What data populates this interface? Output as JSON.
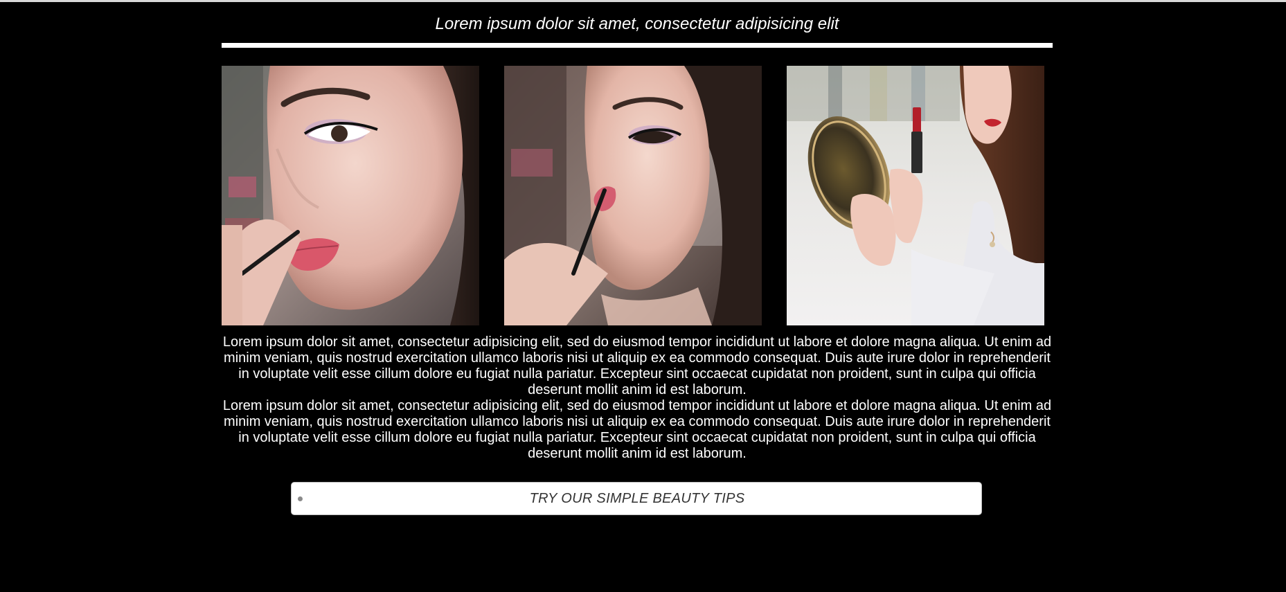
{
  "header": {
    "headline": "Lorem ipsum dolor sit amet, consectetur adipisicing elit"
  },
  "gallery": {
    "photos": [
      {
        "subject": "makeup-artist-applying-lip-liner-closeup"
      },
      {
        "subject": "makeup-artist-applying-lip-liner-profile"
      },
      {
        "subject": "woman-applying-red-lipstick-with-compact-mirror"
      }
    ]
  },
  "content": {
    "paragraphs": [
      "Lorem ipsum dolor sit amet, consectetur adipisicing elit, sed do eiusmod tempor incididunt ut labore et dolore magna aliqua. Ut enim ad minim veniam, quis nostrud exercitation ullamco laboris nisi ut aliquip ex ea commodo consequat. Duis aute irure dolor in reprehenderit in voluptate velit esse cillum dolore eu fugiat nulla pariatur. Excepteur sint occaecat cupidatat non proident, sunt in culpa qui officia deserunt mollit anim id est laborum.",
      "Lorem ipsum dolor sit amet, consectetur adipisicing elit, sed do eiusmod tempor incididunt ut labore et dolore magna aliqua. Ut enim ad minim veniam, quis nostrud exercitation ullamco laboris nisi ut aliquip ex ea commodo consequat. Duis aute irure dolor in reprehenderit in voluptate velit esse cillum dolore eu fugiat nulla pariatur. Excepteur sint occaecat cupidatat non proident, sunt in culpa qui officia deserunt mollit anim id est laborum."
    ]
  },
  "cta": {
    "label": "TRY OUR SIMPLE BEAUTY TIPS"
  },
  "colors": {
    "background": "#000000",
    "text": "#ffffff",
    "cta_background": "#ffffff",
    "cta_text": "#333333"
  }
}
